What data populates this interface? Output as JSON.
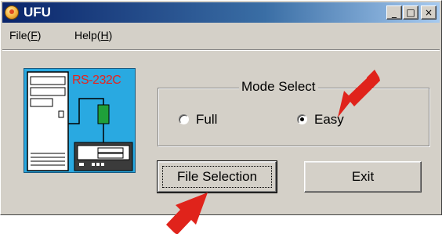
{
  "window": {
    "title": "UFU"
  },
  "title_buttons": {
    "minimize": "_",
    "maximize": "□",
    "close": "×"
  },
  "menu": {
    "file": {
      "prefix": "File(",
      "hotkey": "F",
      "suffix": ")"
    },
    "help": {
      "prefix": "Help(",
      "hotkey": "H",
      "suffix": ")"
    }
  },
  "illustration": {
    "label": "RS-232C"
  },
  "mode_select": {
    "title": "Mode Select",
    "options": [
      {
        "label": "Full",
        "selected": false
      },
      {
        "label": "Easy",
        "selected": true
      }
    ]
  },
  "buttons": {
    "file_selection": "File Selection",
    "exit": "Exit"
  },
  "annotations": {
    "arrow_color": "#e0231b"
  },
  "colors": {
    "titlebar_start": "#0a246a",
    "illustration_bg": "#29a9e1",
    "rs_label": "#e8231e"
  }
}
